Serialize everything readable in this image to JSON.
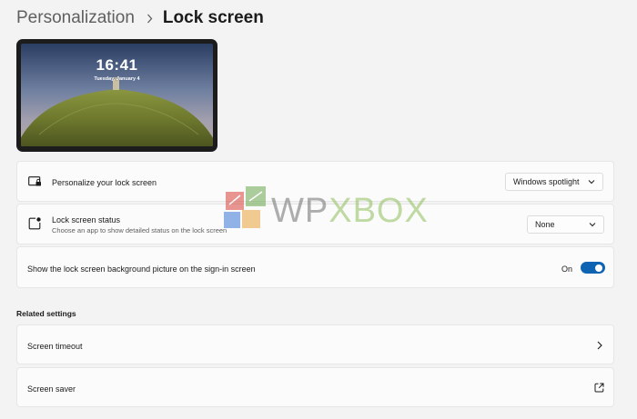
{
  "breadcrumb": {
    "parent": "Personalization",
    "current": "Lock screen"
  },
  "preview": {
    "time": "16:41",
    "date": "Tuesday, January 4"
  },
  "settings": [
    {
      "title": "Personalize your lock screen",
      "icon": "lock-screen-monitor-icon",
      "control": "dropdown",
      "value": "Windows spotlight"
    },
    {
      "title": "Lock screen status",
      "description": "Choose an app to show detailed status on the lock screen",
      "icon": "status-badge-icon",
      "control": "dropdown",
      "value": "None"
    },
    {
      "title": "Show the lock screen background picture on the sign-in screen",
      "control": "toggle",
      "toggle_label": "On",
      "toggle_on": true
    }
  ],
  "related": {
    "title": "Related settings",
    "items": [
      {
        "title": "Screen timeout",
        "icon": "chevron-right-icon"
      },
      {
        "title": "Screen saver",
        "icon": "open-external-icon"
      }
    ]
  },
  "watermark": {
    "text": "WPXBOX"
  },
  "colors": {
    "accent": "#0f63b3",
    "background": "#f3f3f3",
    "card": "#fbfbfb"
  }
}
